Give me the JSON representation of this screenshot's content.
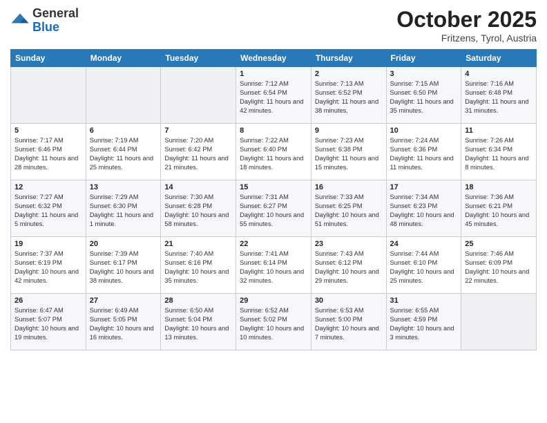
{
  "logo": {
    "general": "General",
    "blue": "Blue"
  },
  "header": {
    "month": "October 2025",
    "location": "Fritzens, Tyrol, Austria"
  },
  "weekdays": [
    "Sunday",
    "Monday",
    "Tuesday",
    "Wednesday",
    "Thursday",
    "Friday",
    "Saturday"
  ],
  "weeks": [
    [
      {
        "day": "",
        "sunrise": "",
        "sunset": "",
        "daylight": ""
      },
      {
        "day": "",
        "sunrise": "",
        "sunset": "",
        "daylight": ""
      },
      {
        "day": "",
        "sunrise": "",
        "sunset": "",
        "daylight": ""
      },
      {
        "day": "1",
        "sunrise": "Sunrise: 7:12 AM",
        "sunset": "Sunset: 6:54 PM",
        "daylight": "Daylight: 11 hours and 42 minutes."
      },
      {
        "day": "2",
        "sunrise": "Sunrise: 7:13 AM",
        "sunset": "Sunset: 6:52 PM",
        "daylight": "Daylight: 11 hours and 38 minutes."
      },
      {
        "day": "3",
        "sunrise": "Sunrise: 7:15 AM",
        "sunset": "Sunset: 6:50 PM",
        "daylight": "Daylight: 11 hours and 35 minutes."
      },
      {
        "day": "4",
        "sunrise": "Sunrise: 7:16 AM",
        "sunset": "Sunset: 6:48 PM",
        "daylight": "Daylight: 11 hours and 31 minutes."
      }
    ],
    [
      {
        "day": "5",
        "sunrise": "Sunrise: 7:17 AM",
        "sunset": "Sunset: 6:46 PM",
        "daylight": "Daylight: 11 hours and 28 minutes."
      },
      {
        "day": "6",
        "sunrise": "Sunrise: 7:19 AM",
        "sunset": "Sunset: 6:44 PM",
        "daylight": "Daylight: 11 hours and 25 minutes."
      },
      {
        "day": "7",
        "sunrise": "Sunrise: 7:20 AM",
        "sunset": "Sunset: 6:42 PM",
        "daylight": "Daylight: 11 hours and 21 minutes."
      },
      {
        "day": "8",
        "sunrise": "Sunrise: 7:22 AM",
        "sunset": "Sunset: 6:40 PM",
        "daylight": "Daylight: 11 hours and 18 minutes."
      },
      {
        "day": "9",
        "sunrise": "Sunrise: 7:23 AM",
        "sunset": "Sunset: 6:38 PM",
        "daylight": "Daylight: 11 hours and 15 minutes."
      },
      {
        "day": "10",
        "sunrise": "Sunrise: 7:24 AM",
        "sunset": "Sunset: 6:36 PM",
        "daylight": "Daylight: 11 hours and 11 minutes."
      },
      {
        "day": "11",
        "sunrise": "Sunrise: 7:26 AM",
        "sunset": "Sunset: 6:34 PM",
        "daylight": "Daylight: 11 hours and 8 minutes."
      }
    ],
    [
      {
        "day": "12",
        "sunrise": "Sunrise: 7:27 AM",
        "sunset": "Sunset: 6:32 PM",
        "daylight": "Daylight: 11 hours and 5 minutes."
      },
      {
        "day": "13",
        "sunrise": "Sunrise: 7:29 AM",
        "sunset": "Sunset: 6:30 PM",
        "daylight": "Daylight: 11 hours and 1 minute."
      },
      {
        "day": "14",
        "sunrise": "Sunrise: 7:30 AM",
        "sunset": "Sunset: 6:28 PM",
        "daylight": "Daylight: 10 hours and 58 minutes."
      },
      {
        "day": "15",
        "sunrise": "Sunrise: 7:31 AM",
        "sunset": "Sunset: 6:27 PM",
        "daylight": "Daylight: 10 hours and 55 minutes."
      },
      {
        "day": "16",
        "sunrise": "Sunrise: 7:33 AM",
        "sunset": "Sunset: 6:25 PM",
        "daylight": "Daylight: 10 hours and 51 minutes."
      },
      {
        "day": "17",
        "sunrise": "Sunrise: 7:34 AM",
        "sunset": "Sunset: 6:23 PM",
        "daylight": "Daylight: 10 hours and 48 minutes."
      },
      {
        "day": "18",
        "sunrise": "Sunrise: 7:36 AM",
        "sunset": "Sunset: 6:21 PM",
        "daylight": "Daylight: 10 hours and 45 minutes."
      }
    ],
    [
      {
        "day": "19",
        "sunrise": "Sunrise: 7:37 AM",
        "sunset": "Sunset: 6:19 PM",
        "daylight": "Daylight: 10 hours and 42 minutes."
      },
      {
        "day": "20",
        "sunrise": "Sunrise: 7:39 AM",
        "sunset": "Sunset: 6:17 PM",
        "daylight": "Daylight: 10 hours and 38 minutes."
      },
      {
        "day": "21",
        "sunrise": "Sunrise: 7:40 AM",
        "sunset": "Sunset: 6:16 PM",
        "daylight": "Daylight: 10 hours and 35 minutes."
      },
      {
        "day": "22",
        "sunrise": "Sunrise: 7:41 AM",
        "sunset": "Sunset: 6:14 PM",
        "daylight": "Daylight: 10 hours and 32 minutes."
      },
      {
        "day": "23",
        "sunrise": "Sunrise: 7:43 AM",
        "sunset": "Sunset: 6:12 PM",
        "daylight": "Daylight: 10 hours and 29 minutes."
      },
      {
        "day": "24",
        "sunrise": "Sunrise: 7:44 AM",
        "sunset": "Sunset: 6:10 PM",
        "daylight": "Daylight: 10 hours and 25 minutes."
      },
      {
        "day": "25",
        "sunrise": "Sunrise: 7:46 AM",
        "sunset": "Sunset: 6:09 PM",
        "daylight": "Daylight: 10 hours and 22 minutes."
      }
    ],
    [
      {
        "day": "26",
        "sunrise": "Sunrise: 6:47 AM",
        "sunset": "Sunset: 5:07 PM",
        "daylight": "Daylight: 10 hours and 19 minutes."
      },
      {
        "day": "27",
        "sunrise": "Sunrise: 6:49 AM",
        "sunset": "Sunset: 5:05 PM",
        "daylight": "Daylight: 10 hours and 16 minutes."
      },
      {
        "day": "28",
        "sunrise": "Sunrise: 6:50 AM",
        "sunset": "Sunset: 5:04 PM",
        "daylight": "Daylight: 10 hours and 13 minutes."
      },
      {
        "day": "29",
        "sunrise": "Sunrise: 6:52 AM",
        "sunset": "Sunset: 5:02 PM",
        "daylight": "Daylight: 10 hours and 10 minutes."
      },
      {
        "day": "30",
        "sunrise": "Sunrise: 6:53 AM",
        "sunset": "Sunset: 5:00 PM",
        "daylight": "Daylight: 10 hours and 7 minutes."
      },
      {
        "day": "31",
        "sunrise": "Sunrise: 6:55 AM",
        "sunset": "Sunset: 4:59 PM",
        "daylight": "Daylight: 10 hours and 3 minutes."
      },
      {
        "day": "",
        "sunrise": "",
        "sunset": "",
        "daylight": ""
      }
    ]
  ]
}
